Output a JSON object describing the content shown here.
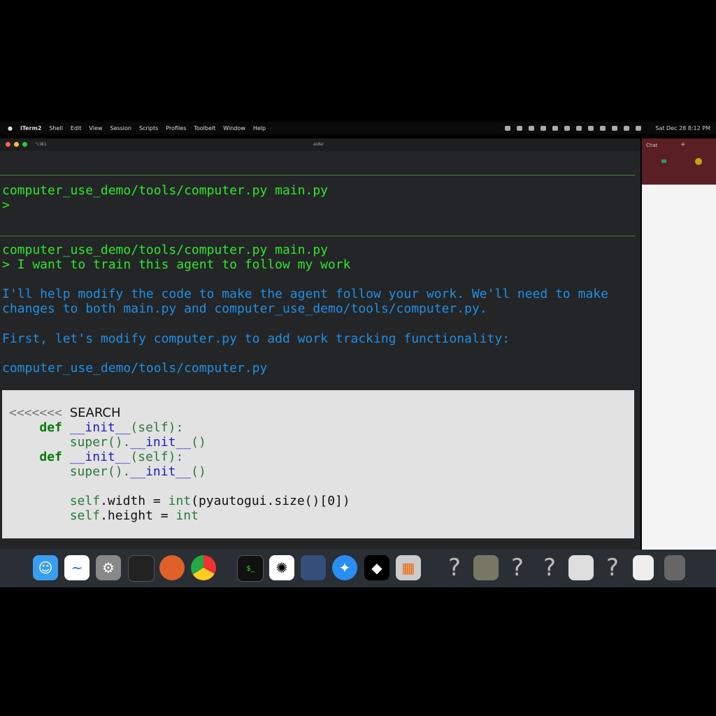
{
  "menubar": {
    "app": "iTerm2",
    "items": [
      "Shell",
      "Edit",
      "View",
      "Session",
      "Scripts",
      "Profiles",
      "Toolbelt",
      "Window",
      "Help"
    ],
    "clock": "Sat Dec 28  8:12 PM"
  },
  "terminal": {
    "tab_label": "⌥⌘1",
    "title": "aider",
    "lines": [
      {
        "text": "computer_use_demo/tools/computer.py main.py",
        "color": "green"
      },
      {
        "text": ">",
        "color": "green"
      },
      {
        "text": "computer_use_demo/tools/computer.py main.py",
        "color": "green"
      },
      {
        "text": "> I want to train this agent to follow my work",
        "color": "green"
      },
      {
        "text": "I'll help modify the code to make the agent follow your work. We'll need to make",
        "color": "blue"
      },
      {
        "text": "changes to both main.py and computer_use_demo/tools/computer.py.",
        "color": "blue"
      },
      {
        "text": "First, let's modify computer.py to add work tracking functionality:",
        "color": "blue"
      },
      {
        "text": "computer_use_demo/tools/computer.py",
        "color": "blue"
      }
    ],
    "code": {
      "marker": "<<<<<<<",
      "search": "SEARCH",
      "def": "def",
      "init": "__init__",
      "self_arg": "(self):",
      "super": "super().",
      "parens": "()",
      "self": "self",
      "width_line": ".width = ",
      "int": "int",
      "width_rest": "(pyautogui.size()[0])",
      "height_line": ".height = "
    }
  },
  "browser": {
    "tab": "Chat"
  },
  "dock": {
    "apps": [
      "Finder",
      "Freeform",
      "System Settings",
      "Activity Monitor",
      "Firefox",
      "Chrome",
      "Terminal",
      "ChatGPT",
      "Xcode Instruments",
      "Safari",
      "Unity",
      "Calculator",
      "Unknown",
      "Preview",
      "Unknown",
      "Unknown",
      "Document",
      "Unknown",
      "File",
      "Trash"
    ]
  }
}
